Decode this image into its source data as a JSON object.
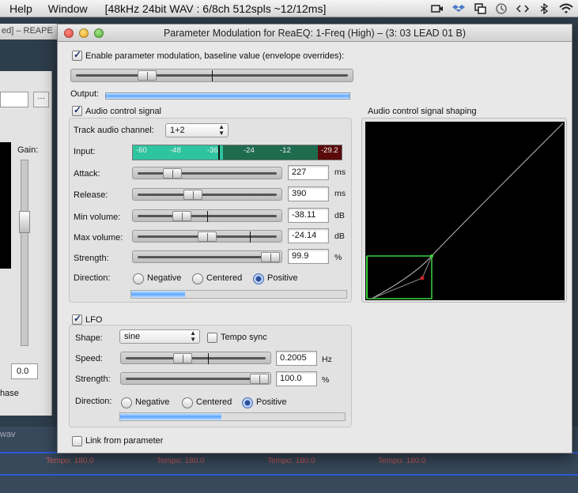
{
  "menubar": {
    "help": "Help",
    "window": "Window",
    "status": "[48kHz 24bit WAV : 6/8ch 512spls ~12/12ms]"
  },
  "background": {
    "reaper_title": "ed] – REAPE",
    "gain_label": "Gain:",
    "gain_value": "0.0",
    "phase_label": "hase",
    "wav_label": "wav",
    "tempo_1": "Tempo: 180.0",
    "tempo_2": "Tempo: 180.0",
    "tempo_3": "Tempo: 180.0",
    "tempo_4": "Tempo: 180.0"
  },
  "window": {
    "title": "Parameter Modulation for ReaEQ: 1-Freq (High) – (3: 03 LEAD 01 B)"
  },
  "baseline": {
    "enable_label": "Enable parameter modulation, baseline value (envelope overrides):",
    "enabled": true,
    "output_label": "Output:"
  },
  "audio": {
    "group_label": "Audio control signal",
    "enabled": true,
    "track_channel_label": "Track audio channel:",
    "track_channel_value": "1+2",
    "input_label": "Input:",
    "input_ticks": [
      "-60",
      "-48",
      "-36",
      "-24",
      "-12",
      "-29.2"
    ],
    "attack_label": "Attack:",
    "attack_value": "227",
    "attack_unit": "ms",
    "release_label": "Release:",
    "release_value": "390",
    "release_unit": "ms",
    "minvol_label": "Min volume:",
    "minvol_value": "-38.11",
    "minvol_unit": "dB",
    "maxvol_label": "Max volume:",
    "maxvol_value": "-24.14",
    "maxvol_unit": "dB",
    "strength_label": "Strength:",
    "strength_value": "99.9",
    "strength_unit": "%",
    "direction_label": "Direction:",
    "dir_negative": "Negative",
    "dir_centered": "Centered",
    "dir_positive": "Positive",
    "direction_selected": "Positive"
  },
  "shaping": {
    "label": "Audio control signal shaping"
  },
  "lfo": {
    "group_label": "LFO",
    "enabled": true,
    "shape_label": "Shape:",
    "shape_value": "sine",
    "tempo_sync_label": "Tempo sync",
    "tempo_sync": false,
    "speed_label": "Speed:",
    "speed_value": "0.2005",
    "speed_unit": "Hz",
    "strength_label": "Strength:",
    "strength_value": "100.0",
    "strength_unit": "%",
    "direction_label": "Direction:",
    "dir_negative": "Negative",
    "dir_centered": "Centered",
    "dir_positive": "Positive",
    "direction_selected": "Positive"
  },
  "link": {
    "label": "Link from parameter",
    "enabled": false
  },
  "colors": {
    "meter_green": "#2fc4a0",
    "meter_dark_green": "#1e6b4f",
    "meter_red": "#5a0a0a",
    "curve_green": "#3cd23c",
    "curve_point": "#d02020"
  }
}
